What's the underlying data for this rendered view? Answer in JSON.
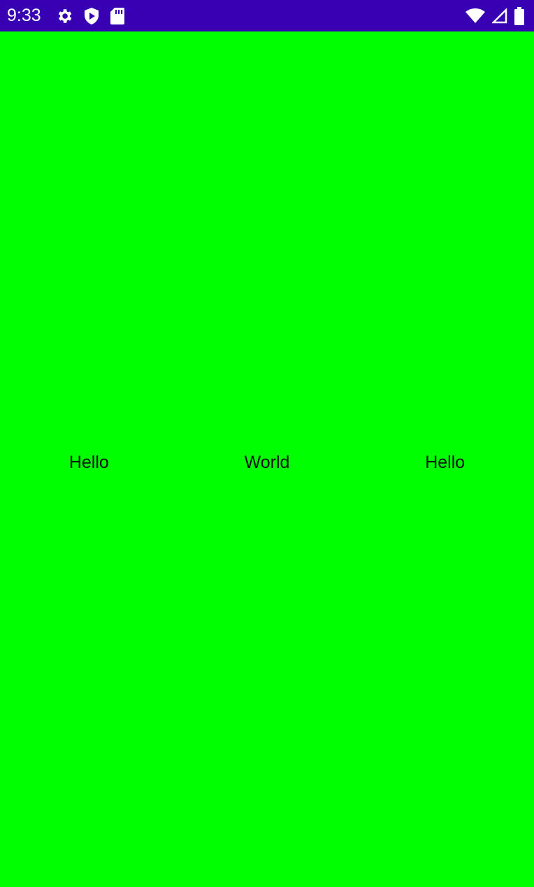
{
  "status_bar": {
    "time": "9:33",
    "background_color": "#3700b3",
    "left_icons": [
      "settings-gear-icon",
      "play-protect-icon",
      "sd-card-icon"
    ],
    "right_icons": [
      "wifi-icon",
      "cellular-signal-icon",
      "battery-icon"
    ]
  },
  "main": {
    "background_color": "#00ff00",
    "labels": [
      "Hello",
      "World",
      "Hello"
    ]
  }
}
